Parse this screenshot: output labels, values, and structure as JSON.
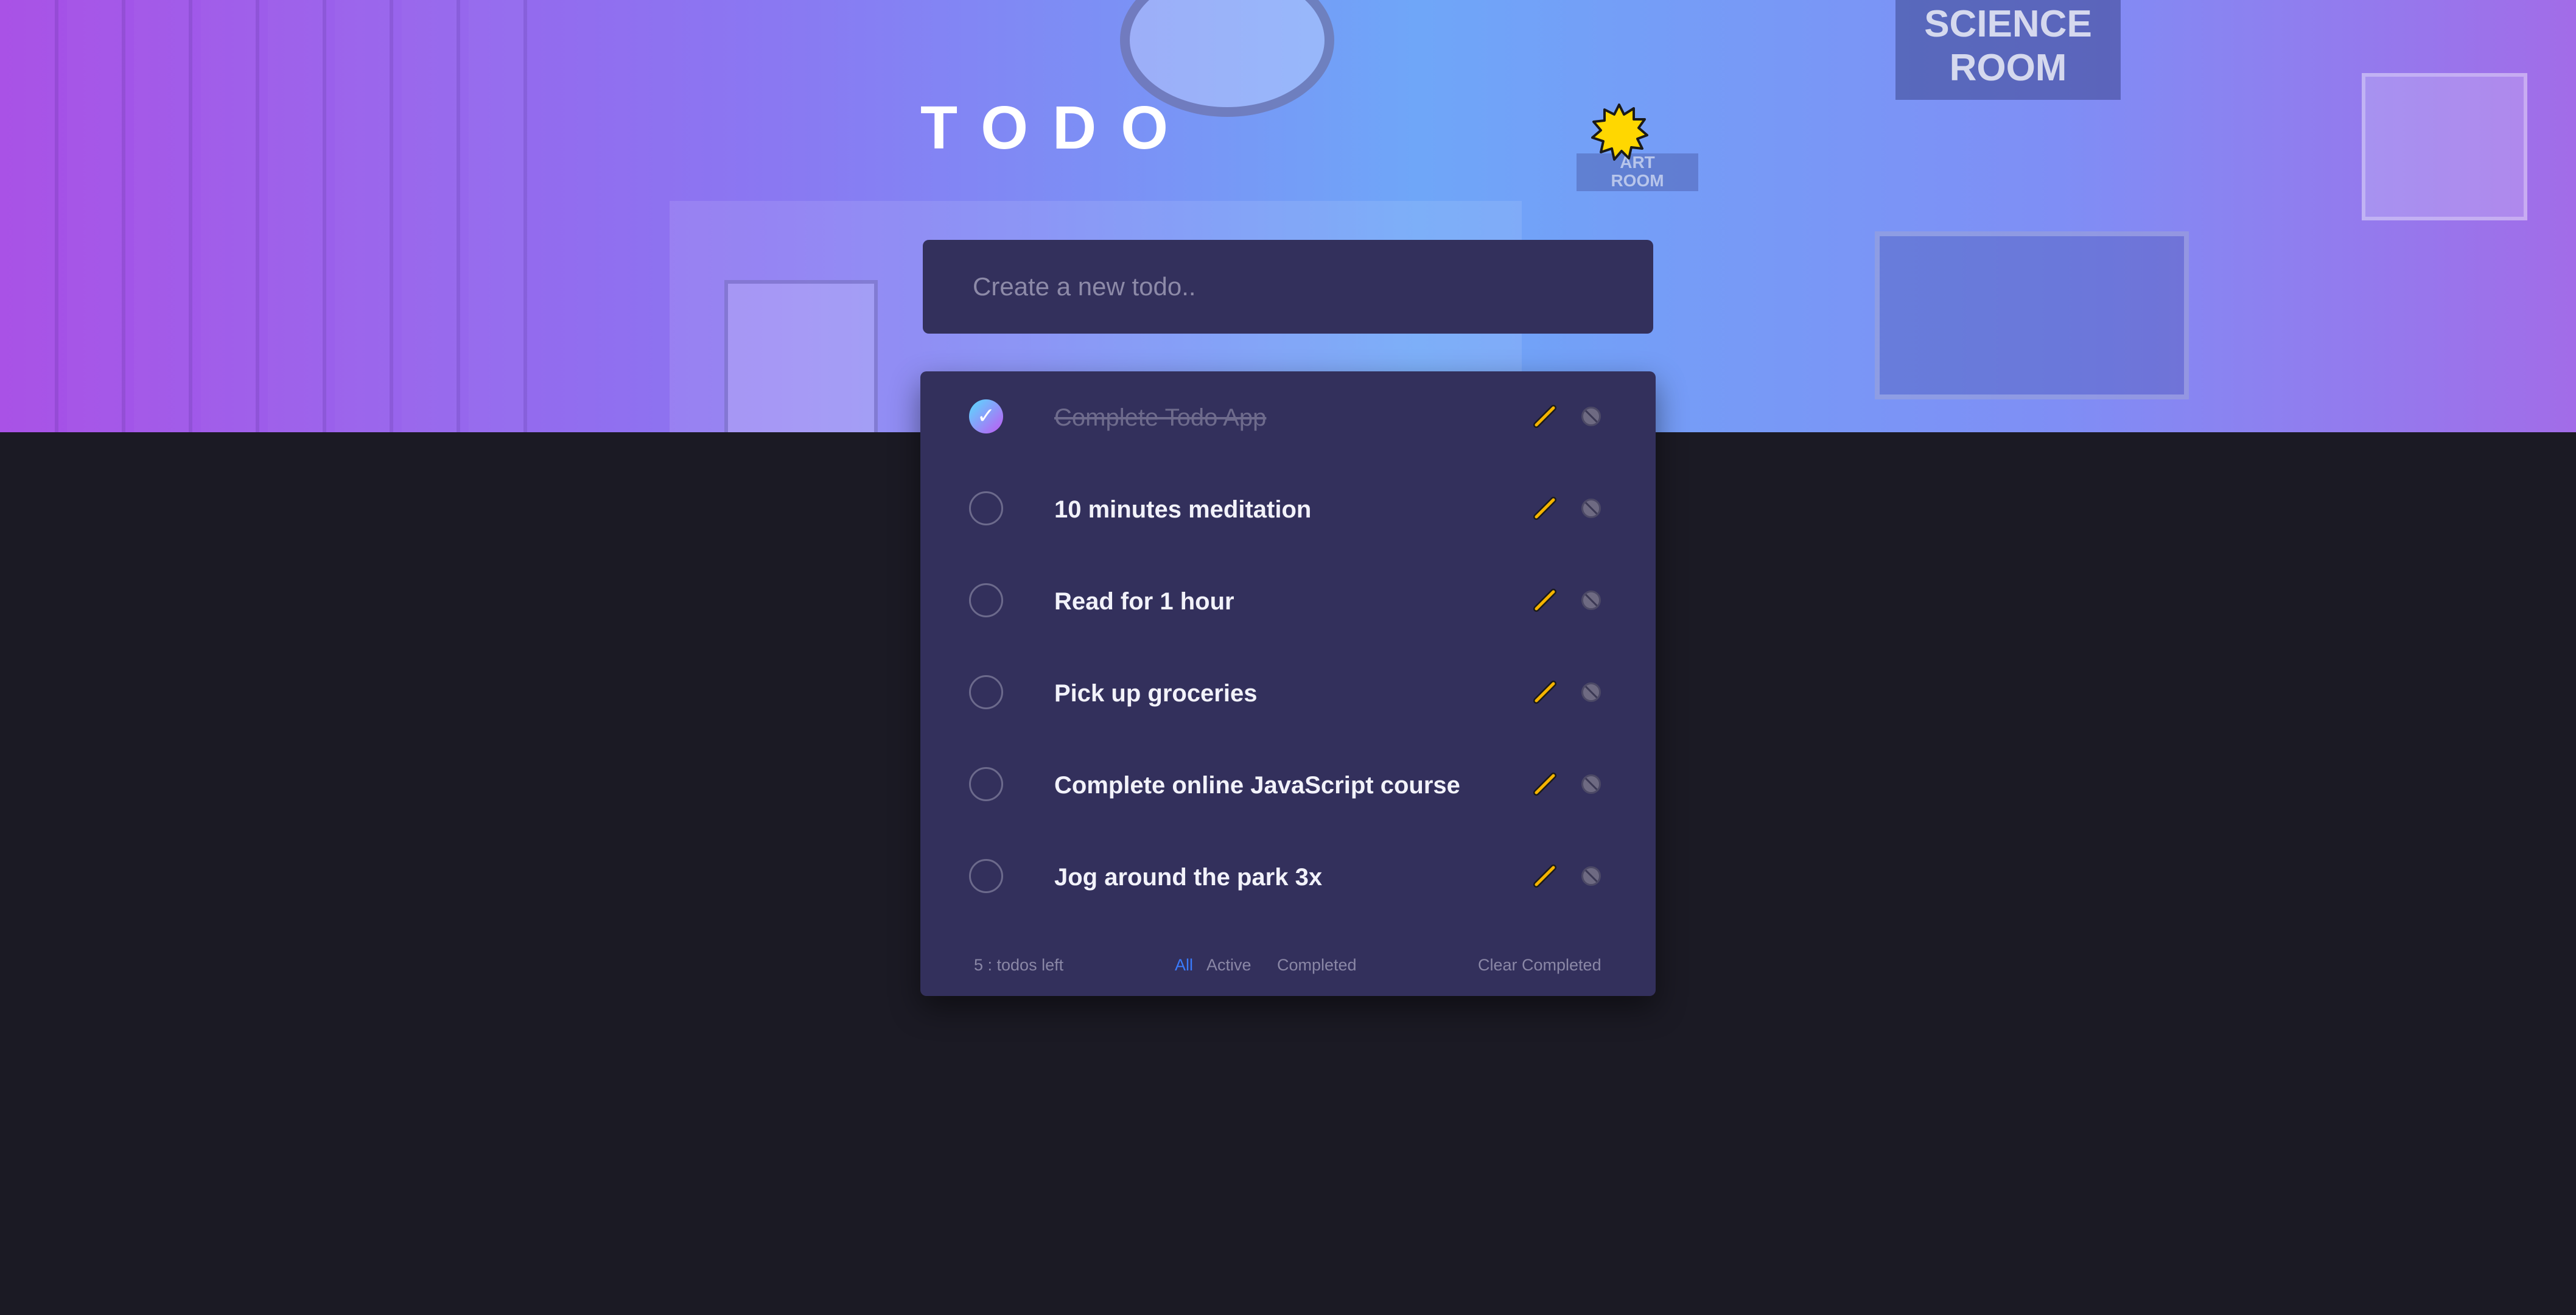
{
  "app": {
    "title": "TODO",
    "theme_toggle_icon": "sun-icon"
  },
  "hero": {
    "sign_line1": "SCIENCE",
    "sign_line2": "ROOM",
    "sign2_line1": "ART",
    "sign2_line2": "ROOM"
  },
  "new_todo": {
    "placeholder": "Create a new todo.."
  },
  "todos": [
    {
      "text": "Complete Todo App",
      "completed": true
    },
    {
      "text": "10 minutes meditation",
      "completed": false
    },
    {
      "text": "Read for 1 hour",
      "completed": false
    },
    {
      "text": "Pick up groceries",
      "completed": false
    },
    {
      "text": "Complete online JavaScript course",
      "completed": false
    },
    {
      "text": "Jog around the park 3x",
      "completed": false
    }
  ],
  "footer": {
    "items_left": "5 : todos left",
    "filter_all": "All",
    "filter_active": "Active",
    "filter_completed": "Completed",
    "clear_completed": "Clear Completed"
  },
  "colors": {
    "accent_filter": "#3a7bfd",
    "card_bg": "#33305c",
    "page_bg": "#1b1a24",
    "check_gradient_start": "#57ddff",
    "check_gradient_end": "#c058f3"
  }
}
